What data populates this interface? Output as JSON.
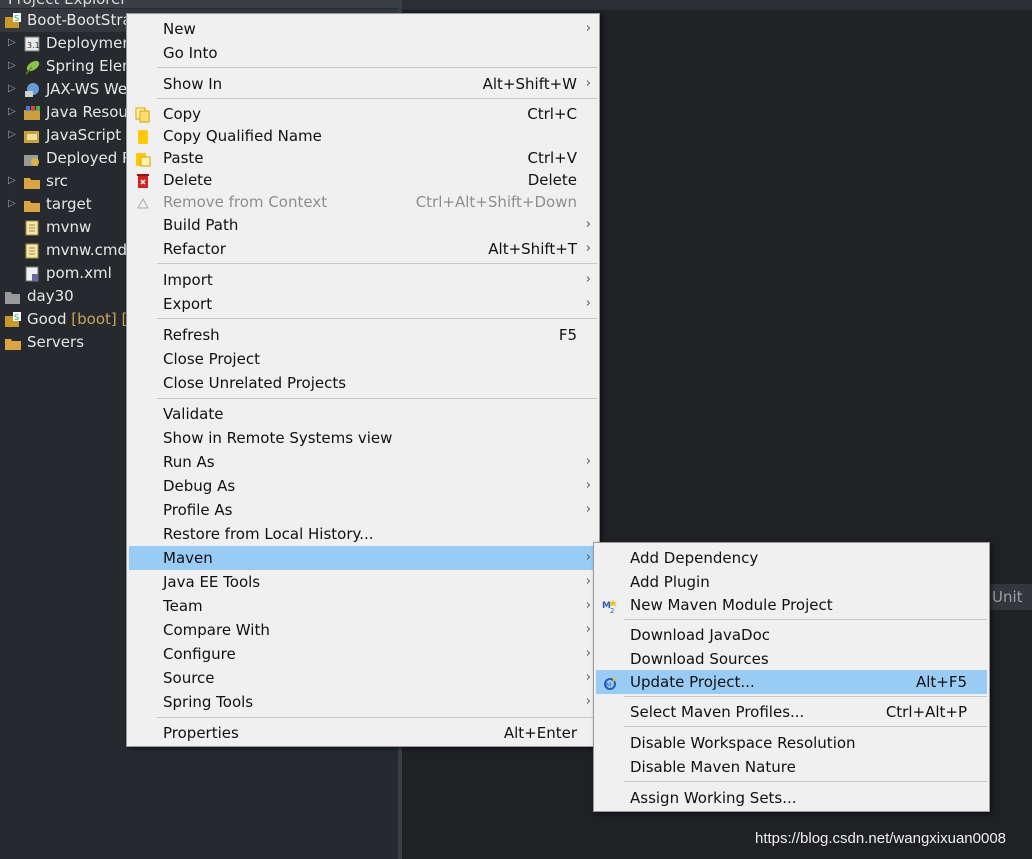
{
  "explorer": {
    "title": "Project Explorer",
    "tree": [
      {
        "label": "Boot-BootStra",
        "icon": "spring-boot-project-icon",
        "selected": true
      },
      {
        "label": "Deploymen",
        "icon": "deployment-descriptor-icon"
      },
      {
        "label": "Spring Elem",
        "icon": "spring-leaf-icon"
      },
      {
        "label": "JAX-WS We",
        "icon": "webservice-icon"
      },
      {
        "label": "Java Resou",
        "icon": "java-resources-icon"
      },
      {
        "label": "JavaScript I",
        "icon": "javascript-icon"
      },
      {
        "label": "Deployed R",
        "icon": "deployed-resources-icon"
      },
      {
        "label": "src",
        "icon": "folder-icon"
      },
      {
        "label": "target",
        "icon": "folder-icon"
      },
      {
        "label": "mvnw",
        "icon": "file-icon"
      },
      {
        "label": "mvnw.cmd",
        "icon": "file-icon"
      },
      {
        "label": "pom.xml",
        "icon": "xml-file-icon"
      },
      {
        "label": "day30",
        "icon": "closed-project-icon"
      },
      {
        "label": "Good",
        "suffix": "[boot] [",
        "icon": "spring-boot-project-icon"
      },
      {
        "label": "Servers",
        "icon": "folder-icon"
      }
    ]
  },
  "editor": {
    "unit_tab": "Unit"
  },
  "context_menu": {
    "items": [
      {
        "label": "New",
        "submenu": true
      },
      {
        "label": "Go Into"
      },
      {
        "label": "Show In",
        "accel": "Alt+Shift+W",
        "submenu": true
      },
      {
        "label": "Copy",
        "accel": "Ctrl+C",
        "icon": "copy-icon"
      },
      {
        "label": "Copy Qualified Name",
        "icon": "copy-qualified-icon"
      },
      {
        "label": "Paste",
        "accel": "Ctrl+V",
        "icon": "paste-icon"
      },
      {
        "label": "Delete",
        "accel": "Delete",
        "icon": "delete-icon"
      },
      {
        "label": "Remove from Context",
        "accel": "Ctrl+Alt+Shift+Down",
        "icon": "remove-context-icon",
        "disabled": true
      },
      {
        "label": "Build Path",
        "submenu": true
      },
      {
        "label": "Refactor",
        "accel": "Alt+Shift+T",
        "submenu": true
      },
      {
        "label": "Import",
        "submenu": true
      },
      {
        "label": "Export",
        "submenu": true
      },
      {
        "label": "Refresh",
        "accel": "F5"
      },
      {
        "label": "Close Project"
      },
      {
        "label": "Close Unrelated Projects"
      },
      {
        "label": "Validate"
      },
      {
        "label": "Show in Remote Systems view"
      },
      {
        "label": "Run As",
        "submenu": true
      },
      {
        "label": "Debug As",
        "submenu": true
      },
      {
        "label": "Profile As",
        "submenu": true
      },
      {
        "label": "Restore from Local History..."
      },
      {
        "label": "Maven",
        "submenu": true,
        "highlighted": true
      },
      {
        "label": "Java EE Tools",
        "submenu": true
      },
      {
        "label": "Team",
        "submenu": true
      },
      {
        "label": "Compare With",
        "submenu": true
      },
      {
        "label": "Configure",
        "submenu": true
      },
      {
        "label": "Source",
        "submenu": true
      },
      {
        "label": "Spring Tools",
        "submenu": true
      },
      {
        "label": "Properties",
        "accel": "Alt+Enter"
      }
    ]
  },
  "maven_submenu": {
    "items": [
      {
        "label": "Add Dependency"
      },
      {
        "label": "Add Plugin"
      },
      {
        "label": "New Maven Module Project",
        "icon": "maven-module-icon"
      },
      {
        "label": "Download JavaDoc"
      },
      {
        "label": "Download Sources"
      },
      {
        "label": "Update Project...",
        "accel": "Alt+F5",
        "icon": "maven-update-icon",
        "highlighted": true
      },
      {
        "label": "Select Maven Profiles...",
        "accel": "Ctrl+Alt+P"
      },
      {
        "label": "Disable Workspace Resolution"
      },
      {
        "label": "Disable Maven Nature"
      },
      {
        "label": "Assign Working Sets..."
      }
    ]
  },
  "submenu_arrow": "›",
  "watermark": "https://blog.csdn.net/wangxixuan0008",
  "colors": {
    "menu_bg": "#f0f0f0",
    "menu_highlight": "#99ccf5",
    "explorer_bg": "#262a2e",
    "editor_bg": "#1f2125",
    "boot_decoration": "#c8a558"
  }
}
